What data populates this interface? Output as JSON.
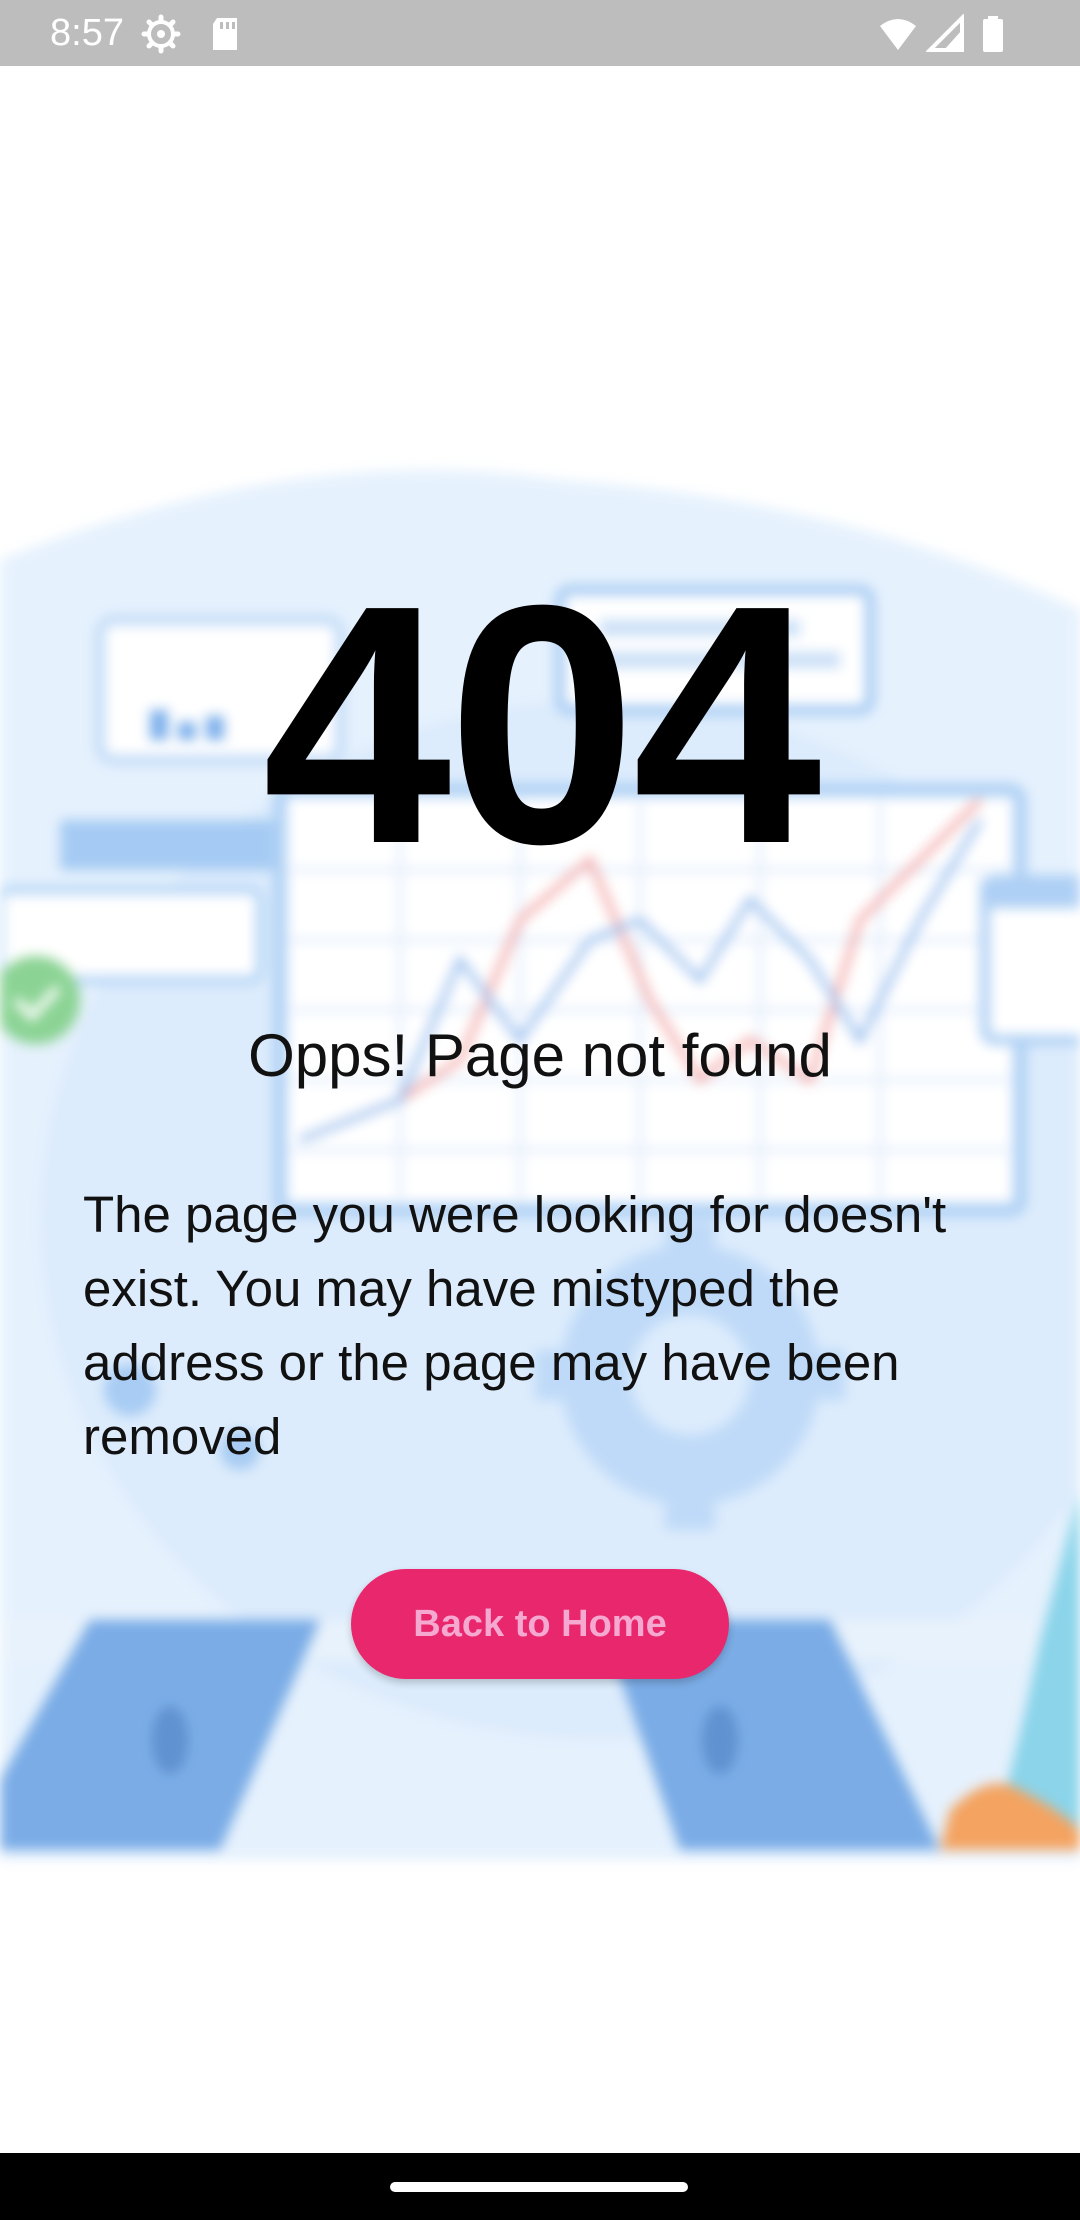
{
  "status_bar": {
    "time": "8:57",
    "left_icons": [
      "settings-icon",
      "sd-card-icon"
    ],
    "right_icons": [
      "wifi-icon",
      "signal-icon",
      "battery-icon"
    ]
  },
  "error": {
    "code": "404",
    "title": "Opps! Page not found",
    "message": "The page you were looking for doesn't exist. You may have mistyped the address or the page may have been removed"
  },
  "actions": {
    "back_home_label": "Back to Home"
  },
  "colors": {
    "accent": "#e8276c",
    "button_text": "#f5a8d0",
    "status_bar": "#bdbdbd"
  }
}
